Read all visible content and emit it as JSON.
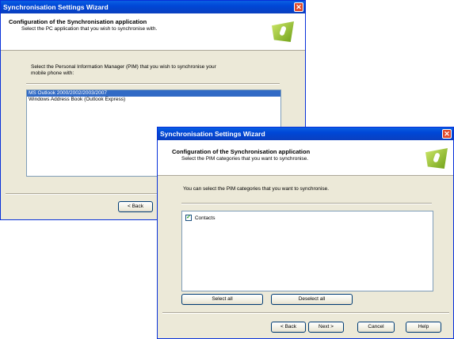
{
  "win1": {
    "title": "Synchronisation Settings Wizard",
    "header_title": "Configuration of the Synchronisation application",
    "header_sub": "Select the PC application that you wish to synchronise with.",
    "prompt_line1": "Select the Personal Information Manager (PIM) that you wish to synchronise your",
    "prompt_line2": "mobile phone with:",
    "apps": [
      "MS Outlook 2000/2002/2003/2007",
      "Windows Address Book (Outlook Express)"
    ],
    "back_label": "< Back"
  },
  "win2": {
    "title": "Synchronisation Settings Wizard",
    "header_title": "Configuration of the Synchronisation application",
    "header_sub": "Select the PIM categories that you want to synchronise.",
    "prompt": "You can select the PIM categories that you want to synchronise.",
    "categories": [
      {
        "label": "Contacts",
        "checked": true
      }
    ],
    "select_all_label": "Select all",
    "deselect_all_label": "Deselect all",
    "back_label": "< Back",
    "next_label": "Next >",
    "cancel_label": "Cancel",
    "help_label": "Help"
  },
  "colors": {
    "titlebar": "#0047d6",
    "selection": "#316ac5",
    "dialog_bg": "#ece9d8"
  }
}
